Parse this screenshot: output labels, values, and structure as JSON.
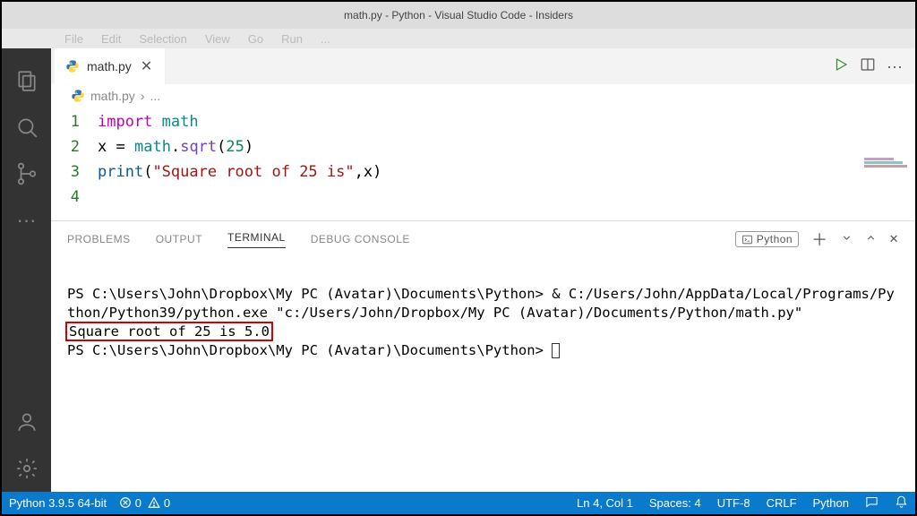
{
  "titlebar": {
    "title": "math.py - Python - Visual Studio Code - Insiders"
  },
  "menubar": {
    "items": [
      "File",
      "Edit",
      "Selection",
      "View",
      "Go",
      "Run",
      "..."
    ]
  },
  "tab": {
    "filename": "math.py",
    "close_tooltip": "Close"
  },
  "breadcrumb": {
    "file": "math.py",
    "sep": "›",
    "more": "..."
  },
  "code": {
    "lines": [
      {
        "n": "1",
        "tokens": [
          [
            "kw-import",
            "import"
          ],
          [
            "",
            ""
          ],
          [
            "mod",
            "math"
          ]
        ]
      },
      {
        "n": "2",
        "tokens": [
          [
            "var",
            "x"
          ],
          [
            "",
            " "
          ],
          [
            "op",
            "="
          ],
          [
            "",
            " "
          ],
          [
            "mod",
            "math"
          ],
          [
            "op",
            "."
          ],
          [
            "func",
            "sqrt"
          ],
          [
            "op",
            "("
          ],
          [
            "num",
            "25"
          ],
          [
            "op",
            ")"
          ]
        ]
      },
      {
        "n": "3",
        "tokens": [
          [
            "builtin",
            "print"
          ],
          [
            "op",
            "("
          ],
          [
            "str",
            "\"Square root of 25 is\""
          ],
          [
            "op",
            ","
          ],
          [
            "var",
            "x"
          ],
          [
            "op",
            ")"
          ]
        ]
      },
      {
        "n": "4",
        "tokens": []
      }
    ]
  },
  "panel": {
    "tabs": [
      "PROBLEMS",
      "OUTPUT",
      "TERMINAL",
      "DEBUG CONSOLE"
    ],
    "active": 2,
    "shell_label": "Python",
    "terminal": {
      "line1": "PS C:\\Users\\John\\Dropbox\\My PC (Avatar)\\Documents\\Python> & C:/Users/John/AppData/Local/Programs/Python/Python39/python.exe \"c:/Users/John/Dropbox/My PC (Avatar)/Documents/Python/math.py\"",
      "highlight": "Square root of 25 is 5.0",
      "line3": "PS C:\\Users\\John\\Dropbox\\My PC (Avatar)\\Documents\\Python> "
    }
  },
  "statusbar": {
    "python": "Python 3.9.5 64-bit",
    "errors": "0",
    "warnings": "0",
    "ln_col": "Ln 4, Col 1",
    "spaces": "Spaces: 4",
    "encoding": "UTF-8",
    "eol": "CRLF",
    "language": "Python"
  }
}
